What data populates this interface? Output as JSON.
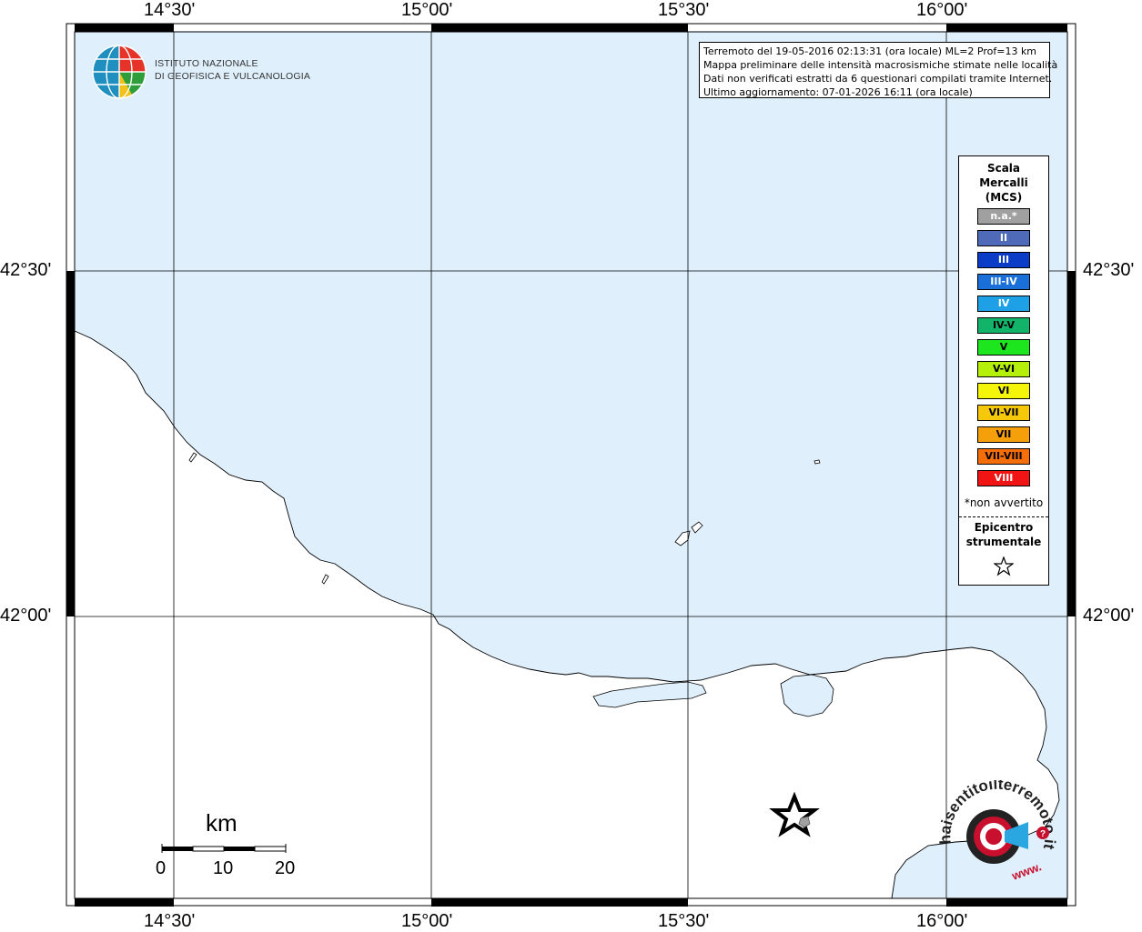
{
  "map": {
    "lon_ticks": [
      "14°30'",
      "15°00'",
      "15°30'",
      "16°00'"
    ],
    "lat_ticks": [
      "42°30'",
      "42°00'"
    ],
    "colors": {
      "sea": "#dff0fc",
      "land": "#ffffff",
      "frame": "#000000"
    }
  },
  "institute": {
    "line1": "ISTITUTO NAZIONALE",
    "line2": "DI GEOFISICA E VULCANOLOGIA"
  },
  "info": {
    "line1": "Terremoto del 19-05-2016 02:13:31 (ora locale) ML=2 Prof=13 km",
    "line2": "Mappa preliminare delle intensità macrosismiche stimate nelle località",
    "line3": "Dati non verificati estratti da 6 questionari compilati tramite Internet.",
    "line4": "Ultimo aggiornamento: 07-01-2026 16:11 (ora locale)"
  },
  "legend": {
    "title1": "Scala",
    "title2": "Mercalli",
    "title3": "(MCS)",
    "items": [
      {
        "label": "n.a.*",
        "color": "#a0a0a0",
        "text": "#ffffff"
      },
      {
        "label": "II",
        "color": "#4f6ab8",
        "text": "#ffffff"
      },
      {
        "label": "III",
        "color": "#0a3cc8",
        "text": "#ffffff"
      },
      {
        "label": "III-IV",
        "color": "#1a6fd8",
        "text": "#ffffff"
      },
      {
        "label": "IV",
        "color": "#1ea0e6",
        "text": "#ffffff"
      },
      {
        "label": "IV-V",
        "color": "#12b46a",
        "text": "#000000"
      },
      {
        "label": "V",
        "color": "#1ee61e",
        "text": "#000000"
      },
      {
        "label": "V-VI",
        "color": "#b4f00a",
        "text": "#000000"
      },
      {
        "label": "VI",
        "color": "#f5f50a",
        "text": "#000000"
      },
      {
        "label": "VI-VII",
        "color": "#f5c80a",
        "text": "#000000"
      },
      {
        "label": "VII",
        "color": "#f5a00a",
        "text": "#000000"
      },
      {
        "label": "VII-VIII",
        "color": "#f56e0a",
        "text": "#000000"
      },
      {
        "label": "VIII",
        "color": "#f01414",
        "text": "#ffffff"
      }
    ],
    "note": "*non avvertito",
    "epicenter1": "Epicentro",
    "epicenter2": "strumentale"
  },
  "scalebar": {
    "unit": "km",
    "labels": [
      "0",
      "10",
      "20"
    ]
  },
  "hst": {
    "text": "haisentitoilterremoto.it",
    "url_text": "www."
  }
}
